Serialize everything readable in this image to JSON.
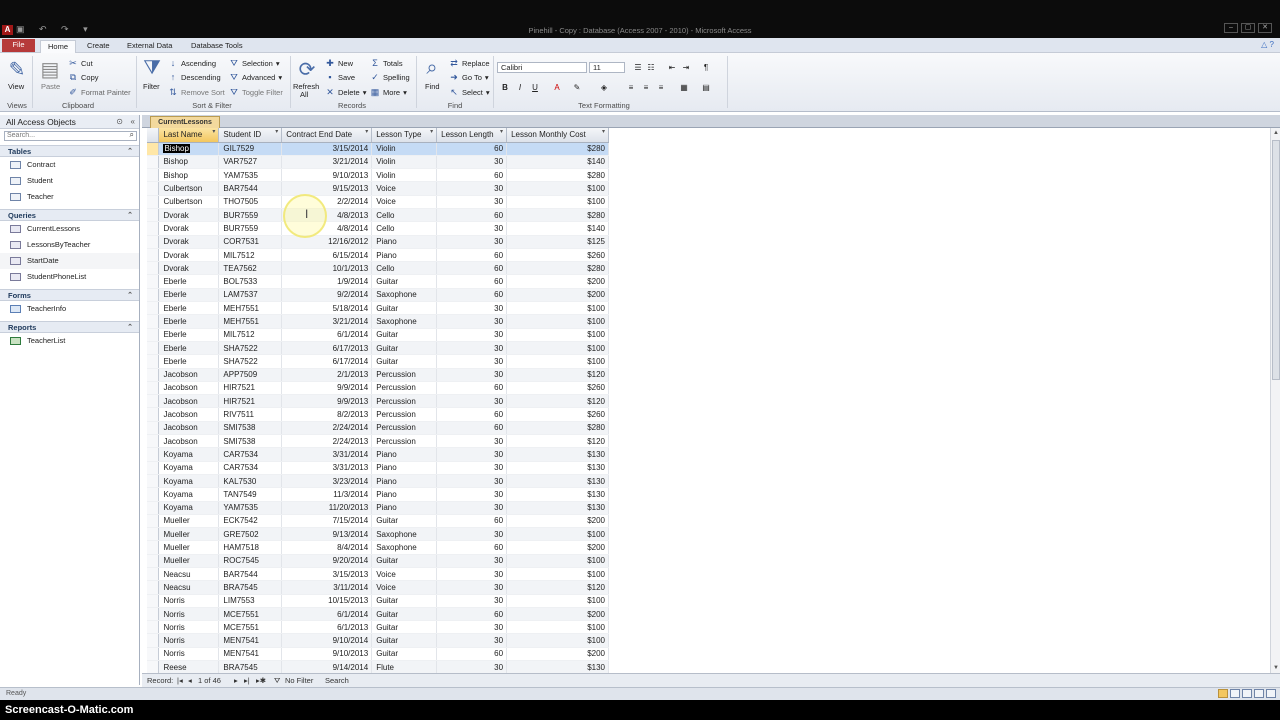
{
  "app": {
    "logo": "A",
    "title": "Pinehill - Copy : Database (Access 2007 - 2010) - Microsoft Access",
    "controls": [
      "–",
      "▢",
      "✕"
    ]
  },
  "ribbon_tabs": [
    "File",
    "Home",
    "Create",
    "External Data",
    "Database Tools"
  ],
  "ribbon": {
    "views": {
      "view": "View",
      "group": "Views"
    },
    "clipboard": {
      "paste": "Paste",
      "cut": "Cut",
      "copy": "Copy",
      "format_painter": "Format Painter",
      "group": "Clipboard"
    },
    "sort_filter": {
      "filter": "Filter",
      "ascending": "Ascending",
      "descending": "Descending",
      "remove_sort": "Remove Sort",
      "selection": "Selection",
      "advanced": "Advanced",
      "toggle_filter": "Toggle Filter",
      "group": "Sort & Filter"
    },
    "records": {
      "refresh": "Refresh",
      "refresh_all": "All",
      "new": "New",
      "save": "Save",
      "delete": "Delete",
      "totals": "Totals",
      "spelling": "Spelling",
      "more": "More",
      "group": "Records"
    },
    "find": {
      "find": "Find",
      "replace": "Replace",
      "goto": "Go To",
      "select": "Select",
      "group": "Find"
    },
    "text_formatting": {
      "font": "Calibri",
      "size": "11",
      "bold": "B",
      "italic": "I",
      "underline": "U",
      "group": "Text Formatting"
    }
  },
  "navpane": {
    "header": "All Access Objects",
    "search_placeholder": "Search...",
    "groups": [
      {
        "name": "Tables",
        "items": [
          "Contract",
          "Student",
          "Teacher"
        ]
      },
      {
        "name": "Queries",
        "items": [
          "CurrentLessons",
          "LessonsByTeacher",
          "StartDate",
          "StudentPhoneList"
        ]
      },
      {
        "name": "Forms",
        "items": [
          "TeacherInfo"
        ]
      },
      {
        "name": "Reports",
        "items": [
          "TeacherList"
        ]
      }
    ]
  },
  "document": {
    "tab": "CurrentLessons",
    "columns": [
      "Last Name",
      "Student ID",
      "Contract End Date",
      "Lesson Type",
      "Lesson Length",
      "Lesson Monthly Cost"
    ],
    "rows": [
      [
        "Bishop",
        "GIL7529",
        "3/15/2014",
        "Violin",
        "60",
        "$280"
      ],
      [
        "Bishop",
        "VAR7527",
        "3/21/2014",
        "Violin",
        "30",
        "$140"
      ],
      [
        "Bishop",
        "YAM7535",
        "9/10/2013",
        "Violin",
        "60",
        "$280"
      ],
      [
        "Culbertson",
        "BAR7544",
        "9/15/2013",
        "Voice",
        "30",
        "$100"
      ],
      [
        "Culbertson",
        "THO7505",
        "2/2/2014",
        "Voice",
        "30",
        "$100"
      ],
      [
        "Dvorak",
        "BUR7559",
        "4/8/2013",
        "Cello",
        "60",
        "$280"
      ],
      [
        "Dvorak",
        "BUR7559",
        "4/8/2014",
        "Cello",
        "30",
        "$140"
      ],
      [
        "Dvorak",
        "COR7531",
        "12/16/2012",
        "Piano",
        "30",
        "$125"
      ],
      [
        "Dvorak",
        "MIL7512",
        "6/15/2014",
        "Piano",
        "60",
        "$260"
      ],
      [
        "Dvorak",
        "TEA7562",
        "10/1/2013",
        "Cello",
        "60",
        "$280"
      ],
      [
        "Eberle",
        "BOL7533",
        "1/9/2014",
        "Guitar",
        "60",
        "$200"
      ],
      [
        "Eberle",
        "LAM7537",
        "9/2/2014",
        "Saxophone",
        "60",
        "$200"
      ],
      [
        "Eberle",
        "MEH7551",
        "5/18/2014",
        "Guitar",
        "30",
        "$100"
      ],
      [
        "Eberle",
        "MEH7551",
        "3/21/2014",
        "Saxophone",
        "30",
        "$100"
      ],
      [
        "Eberle",
        "MIL7512",
        "6/1/2014",
        "Guitar",
        "30",
        "$100"
      ],
      [
        "Eberle",
        "SHA7522",
        "6/17/2013",
        "Guitar",
        "30",
        "$100"
      ],
      [
        "Eberle",
        "SHA7522",
        "6/17/2014",
        "Guitar",
        "30",
        "$100"
      ],
      [
        "Jacobson",
        "APP7509",
        "2/1/2013",
        "Percussion",
        "30",
        "$120"
      ],
      [
        "Jacobson",
        "HIR7521",
        "9/9/2014",
        "Percussion",
        "60",
        "$260"
      ],
      [
        "Jacobson",
        "HIR7521",
        "9/9/2013",
        "Percussion",
        "30",
        "$120"
      ],
      [
        "Jacobson",
        "RIV7511",
        "8/2/2013",
        "Percussion",
        "60",
        "$260"
      ],
      [
        "Jacobson",
        "SMI7538",
        "2/24/2014",
        "Percussion",
        "60",
        "$280"
      ],
      [
        "Jacobson",
        "SMI7538",
        "2/24/2013",
        "Percussion",
        "30",
        "$120"
      ],
      [
        "Koyama",
        "CAR7534",
        "3/31/2014",
        "Piano",
        "30",
        "$130"
      ],
      [
        "Koyama",
        "CAR7534",
        "3/31/2013",
        "Piano",
        "30",
        "$130"
      ],
      [
        "Koyama",
        "KAL7530",
        "3/23/2014",
        "Piano",
        "30",
        "$130"
      ],
      [
        "Koyama",
        "TAN7549",
        "11/3/2014",
        "Piano",
        "30",
        "$130"
      ],
      [
        "Koyama",
        "YAM7535",
        "11/20/2013",
        "Piano",
        "30",
        "$130"
      ],
      [
        "Mueller",
        "ECK7542",
        "7/15/2014",
        "Guitar",
        "60",
        "$200"
      ],
      [
        "Mueller",
        "GRE7502",
        "9/13/2014",
        "Saxophone",
        "30",
        "$100"
      ],
      [
        "Mueller",
        "HAM7518",
        "8/4/2014",
        "Saxophone",
        "60",
        "$200"
      ],
      [
        "Mueller",
        "ROC7545",
        "9/20/2014",
        "Guitar",
        "30",
        "$100"
      ],
      [
        "Neacsu",
        "BAR7544",
        "3/15/2013",
        "Voice",
        "30",
        "$100"
      ],
      [
        "Neacsu",
        "BRA7545",
        "3/11/2014",
        "Voice",
        "30",
        "$120"
      ],
      [
        "Norris",
        "LIM7553",
        "10/15/2013",
        "Guitar",
        "30",
        "$100"
      ],
      [
        "Norris",
        "MCE7551",
        "6/1/2014",
        "Guitar",
        "60",
        "$200"
      ],
      [
        "Norris",
        "MCE7551",
        "6/1/2013",
        "Guitar",
        "30",
        "$100"
      ],
      [
        "Norris",
        "MEN7541",
        "9/10/2014",
        "Guitar",
        "30",
        "$100"
      ],
      [
        "Norris",
        "MEN7541",
        "9/10/2013",
        "Guitar",
        "60",
        "$200"
      ],
      [
        "Reese",
        "BRA7545",
        "9/14/2014",
        "Flute",
        "30",
        "$130"
      ]
    ],
    "record_nav": {
      "label": "Record:",
      "position": "1 of 46",
      "filter": "No Filter",
      "search": "Search"
    }
  },
  "status": {
    "left": "Ready"
  },
  "watermark": "Screencast-O-Matic.com"
}
